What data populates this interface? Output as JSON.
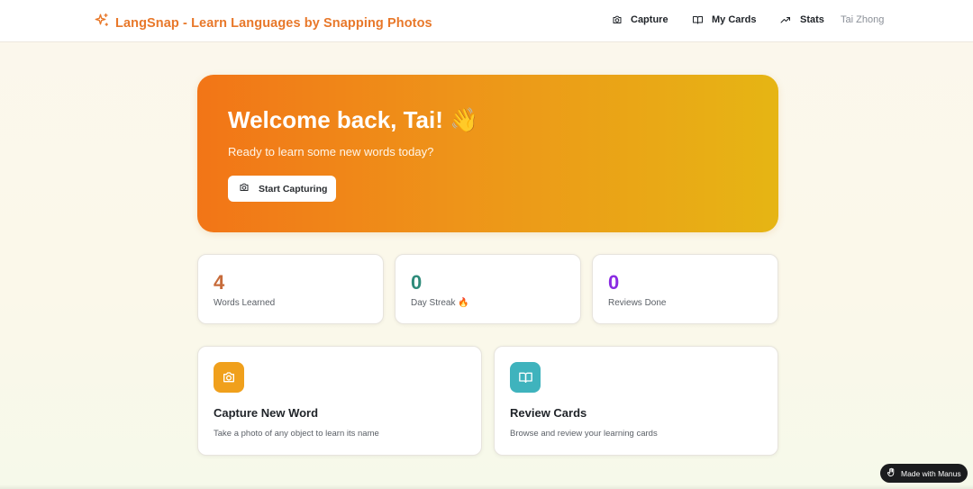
{
  "app": {
    "title": "LangSnap - Learn Languages by Snapping Photos",
    "brand_color": "#e8782a"
  },
  "nav": {
    "items": [
      {
        "label": "Capture",
        "icon": "camera-icon"
      },
      {
        "label": "My Cards",
        "icon": "book-open-icon"
      },
      {
        "label": "Stats",
        "icon": "trending-up-icon"
      }
    ],
    "user": "Tai Zhong"
  },
  "hero": {
    "title": "Welcome back, Tai! 👋",
    "subtitle": "Ready to learn some new words today?",
    "button_label": "Start Capturing",
    "button_icon": "camera-icon"
  },
  "stats": [
    {
      "value": "4",
      "label": "Words Learned",
      "color": "#c76b3a"
    },
    {
      "value": "0",
      "label": "Day Streak 🔥",
      "color": "#2e8b7a"
    },
    {
      "value": "0",
      "label": "Reviews Done",
      "color": "#8a2be2"
    }
  ],
  "actions": [
    {
      "title": "Capture New Word",
      "description": "Take a photo of any object to learn its name",
      "icon": "camera-icon",
      "icon_bg": "#f0a01c"
    },
    {
      "title": "Review Cards",
      "description": "Browse and review your learning cards",
      "icon": "book-open-icon",
      "icon_bg": "#3fb3bd"
    }
  ],
  "badge": {
    "label": "Made with Manus",
    "icon": "manus-hand-icon"
  }
}
